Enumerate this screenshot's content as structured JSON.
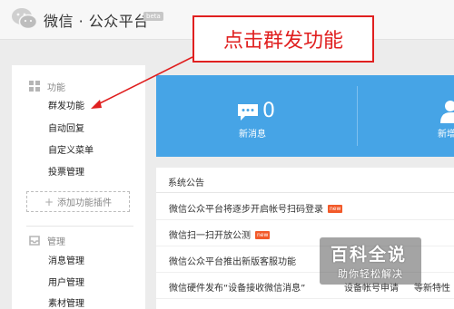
{
  "header": {
    "brand": "微信 · 公众平台",
    "beta": "beta"
  },
  "annotation": {
    "text": "点击群发功能",
    "color": "#e02020"
  },
  "sidebar": {
    "section_function": "功能",
    "items": [
      "群发功能",
      "自动回复",
      "自定义菜单",
      "投票管理"
    ],
    "add_plugin": "添加功能插件",
    "section_manage": "管理",
    "manage_items": [
      "消息管理",
      "用户管理",
      "素材管理"
    ]
  },
  "stats": {
    "new_messages_count": "0",
    "new_messages_label": "新消息",
    "new_users_label": "新增",
    "color": "#46a4e6"
  },
  "announcements": {
    "title": "系统公告",
    "rows": [
      {
        "text": "微信公众平台将逐步开启帐号扫码登录",
        "badge": "new"
      },
      {
        "text": "微信扫一扫开放公测",
        "badge": "new"
      },
      {
        "text": "微信公众平台推出新版客服功能",
        "badge": ""
      },
      {
        "text": "微信硬件发布“设备接收微信消息”",
        "badge": "",
        "extra1": "设备帐号申请",
        "extra2": "等新特性"
      }
    ]
  },
  "watermark": {
    "main": "百科全说",
    "sub": "助你轻松解决"
  }
}
